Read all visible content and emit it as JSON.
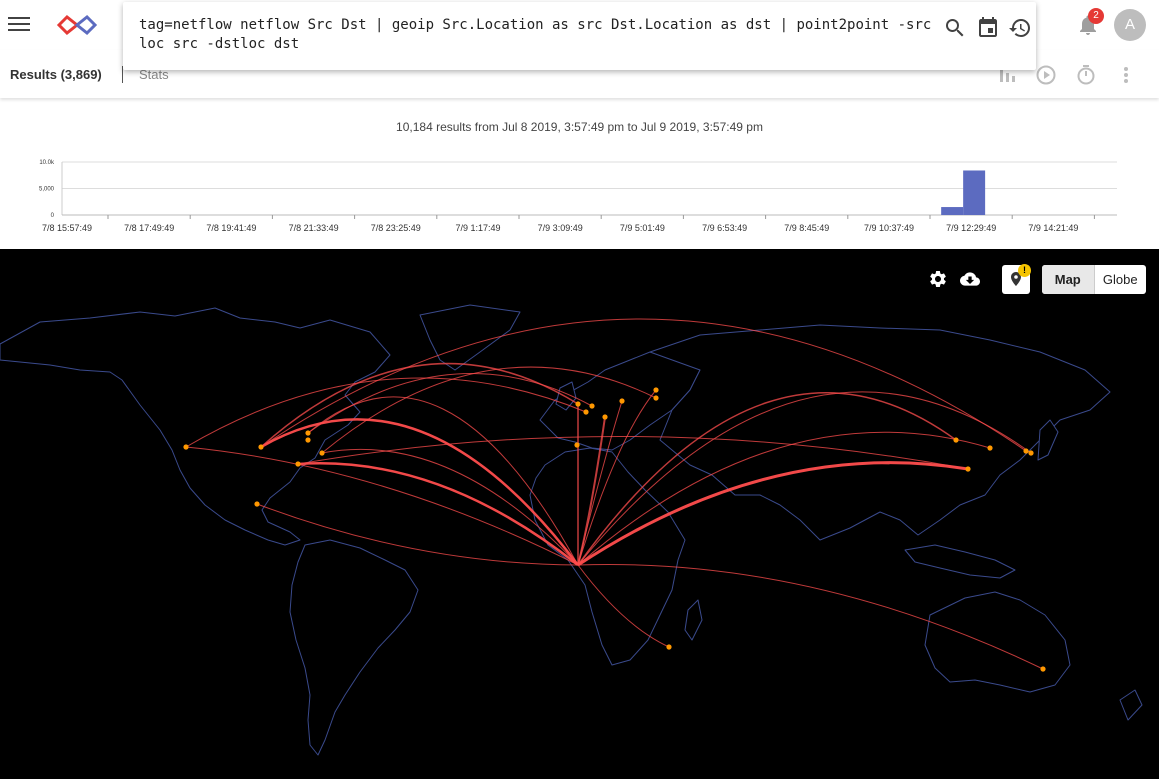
{
  "header": {
    "query": "tag=netflow netflow Src Dst | geoip Src.Location as src Dst.Location as dst | point2point -srcloc src -dstloc dst",
    "notification_count": "2",
    "avatar_initial": "A",
    "icons": [
      "menu-icon",
      "app-logo",
      "search-icon",
      "calendar-icon",
      "history-icon",
      "bell-icon"
    ]
  },
  "tabs": {
    "results_label": "Results (3,869)",
    "stats_label": "Stats",
    "icons": [
      "bar-chart-icon",
      "play-circle-icon",
      "timer-icon",
      "more-vert-icon"
    ]
  },
  "summary": "10,184 results from Jul 8 2019, 3:57:49 pm to Jul 9 2019, 3:57:49 pm",
  "chart_data": {
    "type": "bar",
    "y_ticks": [
      "10.0k",
      "5,000",
      "0"
    ],
    "ylim": [
      0,
      10000
    ],
    "x_tick_labels": [
      "7/8 15:57:49",
      "7/8 17:49:49",
      "7/8 19:41:49",
      "7/8 21:33:49",
      "7/8 23:25:49",
      "7/9 1:17:49",
      "7/9 3:09:49",
      "7/9 5:01:49",
      "7/9 6:53:49",
      "7/9 8:45:49",
      "7/9 10:37:49",
      "7/9 12:29:49",
      "7/9 14:21:49"
    ],
    "bucket_count": 48,
    "values": [
      0,
      0,
      0,
      0,
      0,
      0,
      0,
      0,
      0,
      0,
      0,
      0,
      0,
      0,
      0,
      0,
      0,
      0,
      0,
      0,
      0,
      0,
      0,
      0,
      0,
      0,
      0,
      0,
      0,
      0,
      0,
      0,
      0,
      0,
      0,
      0,
      0,
      0,
      0,
      0,
      1500,
      8400,
      0,
      0,
      0,
      0,
      0,
      0
    ],
    "bar_color": "#5c6bc0",
    "grid": true
  },
  "map": {
    "view_modes": [
      "Map",
      "Globe"
    ],
    "active_view": "Map",
    "warning_badge": "!",
    "icons": [
      "settings-icon",
      "cloud-download-icon",
      "location-pin-icon"
    ],
    "arc_color": "#ff4d4d",
    "point_color": "#ff9800",
    "land_outline_color": "#3a4a8c"
  }
}
